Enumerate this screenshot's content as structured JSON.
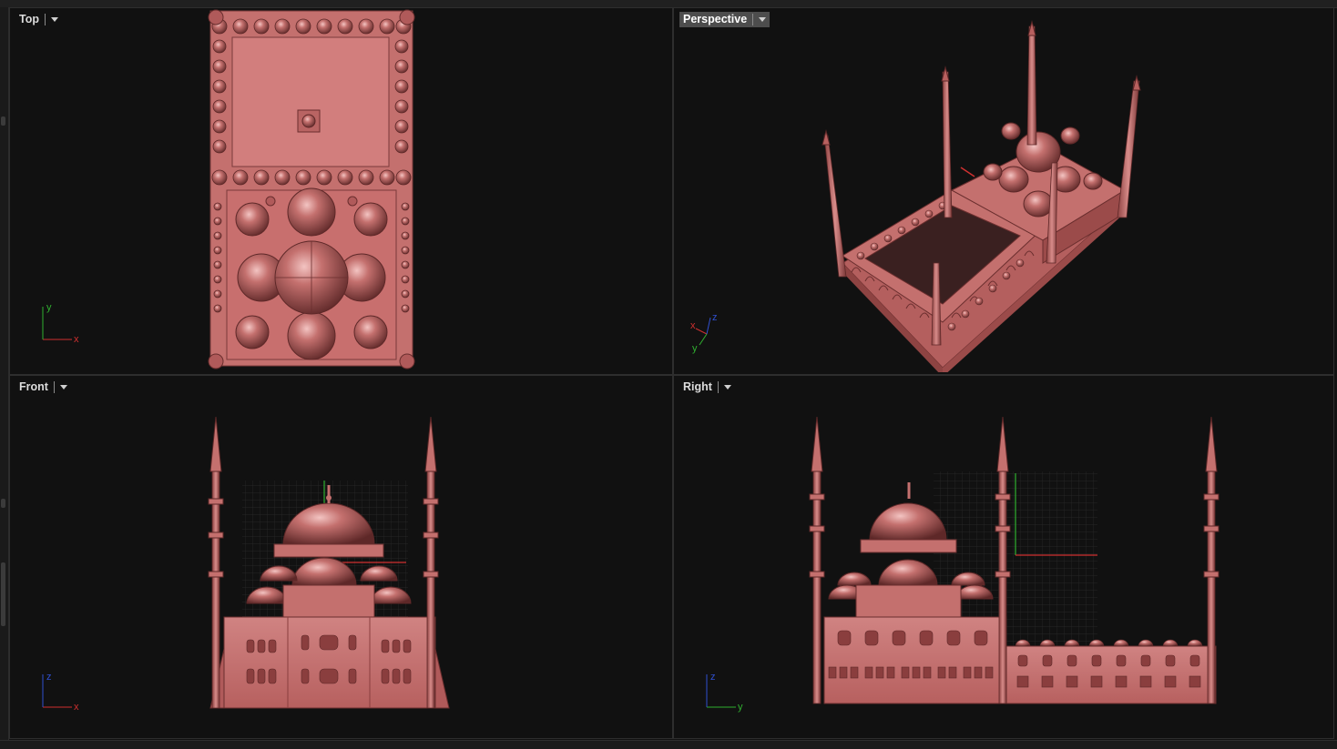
{
  "viewports": {
    "top": {
      "label": "Top",
      "axis": {
        "a": "y",
        "b": "x"
      }
    },
    "perspective": {
      "label": "Perspective",
      "axis": {
        "a": "x",
        "b": "z",
        "c": "y"
      }
    },
    "front": {
      "label": "Front",
      "axis": {
        "a": "z",
        "b": "x"
      }
    },
    "right": {
      "label": "Right",
      "axis": {
        "a": "z",
        "b": "y"
      }
    }
  },
  "colors": {
    "model": "#c4706e",
    "model_dark": "#7a3a3a",
    "axis_x": "#d03030",
    "axis_y": "#30b030",
    "axis_z": "#3050d0"
  },
  "icons": [
    "dropdown-arrow-icon"
  ]
}
